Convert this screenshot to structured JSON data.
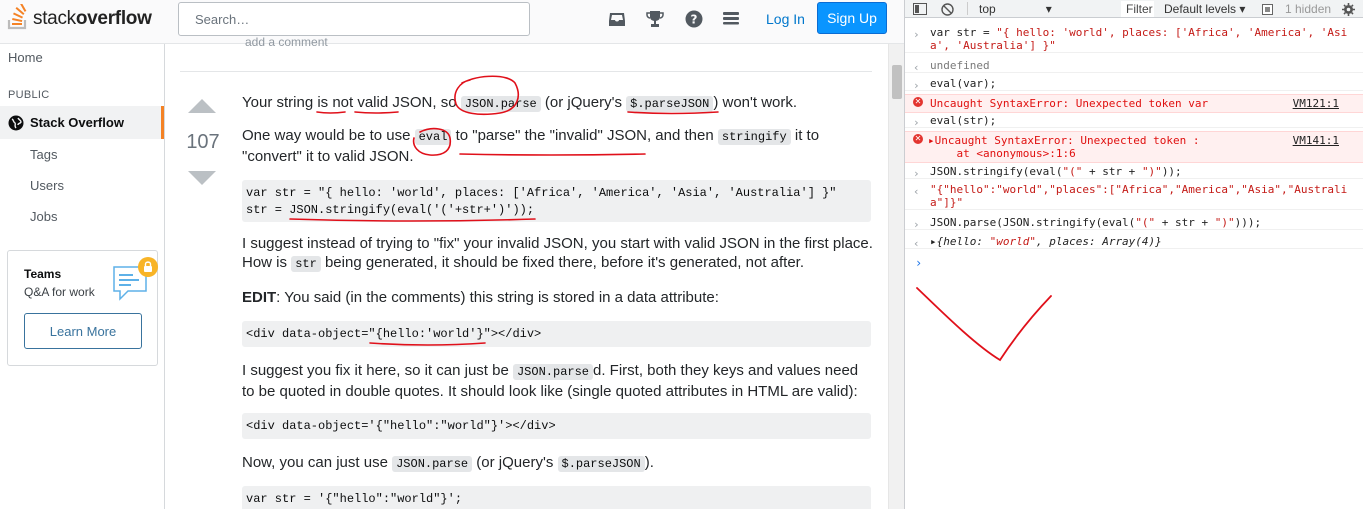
{
  "header": {
    "logo_text_light": "stack",
    "logo_text_bold": "overflow",
    "search_placeholder": "Search…",
    "login_label": "Log In",
    "signup_label": "Sign Up"
  },
  "leftnav": {
    "home": "Home",
    "public_heading": "PUBLIC",
    "stack_overflow": "Stack Overflow",
    "tags": "Tags",
    "users": "Users",
    "jobs": "Jobs",
    "teams_title": "Teams",
    "teams_subtitle": "Q&A for work",
    "learn_more": "Learn More"
  },
  "answer": {
    "add_comment": "add a comment",
    "votes": "107",
    "p1_a": "Your string is not valid JSON, so ",
    "p1_code1": "JSON.parse",
    "p1_b": " (or jQuery's ",
    "p1_code2": "$.parseJSON",
    "p1_c": ") won't work.",
    "p2_a": "One way would be to use ",
    "p2_code1": "eval",
    "p2_b": " to \"parse\" the \"invalid\" JSON, and then ",
    "p2_code2": "stringify",
    "p2_c": " it to \"convert\" it to valid JSON.",
    "code1": "var str = \"{ hello: 'world', places: ['Africa', 'America', 'Asia', 'Australia'] }\"\nstr = JSON.stringify(eval('('+str+')'));",
    "p3_a": "I suggest instead of trying to \"fix\" your invalid JSON, you start with valid JSON in the first place. How is ",
    "p3_code": "str",
    "p3_b": " being generated, it should be fixed there, before it's generated, not after.",
    "p4_bold": "EDIT",
    "p4_rest": ": You said (in the comments) this string is stored in a data attribute:",
    "code2": "<div data-object=\"{hello:'world'}\"></div>",
    "p5_a": "I suggest you fix it here, so it can just be ",
    "p5_code": "JSON.parse",
    "p5_b": "d. First, both they keys and values need to be quoted in double quotes. It should look like (single quoted attributes in HTML are valid):",
    "code3": "<div data-object='{\"hello\":\"world\"}'></div>",
    "p6_a": "Now, you can just use ",
    "p6_code1": "JSON.parse",
    "p6_b": " (or jQuery's ",
    "p6_code2": "$.parseJSON",
    "p6_c": ").",
    "code4": "var str = '{\"hello\":\"world\"}';"
  },
  "devtools": {
    "context": "top",
    "filter": "Filter",
    "levels": "Default levels ▾",
    "hidden": "1 hidden",
    "lines": {
      "l1_a": "var str = ",
      "l1_str": "\"{ hello: 'world', places: ['Africa', 'America', 'Asia', 'Australia'] }\"",
      "l2": "undefined",
      "l3": "eval(var);",
      "l4": "Uncaught SyntaxError: Unexpected token var",
      "l4_src": "VM121:1",
      "l5": "eval(str);",
      "l6": "Uncaught SyntaxError: Unexpected token :\n    at <anonymous>:1:6",
      "l6_src": "VM141:1",
      "l7_a": "JSON.stringify(eval(",
      "l7_s1": "\"(\"",
      "l7_b": " + str + ",
      "l7_s2": "\")\"",
      "l7_c": "));",
      "l8": "\"{\"hello\":\"world\",\"places\":[\"Africa\",\"America\",\"Asia\",\"Australia\"]}\"",
      "l9_a": "JSON.parse(JSON.stringify(eval(",
      "l9_s1": "\"(\"",
      "l9_b": " + str + ",
      "l9_s2": "\")\"",
      "l9_c": ")));",
      "l10_a": "{hello: ",
      "l10_s": "\"world\"",
      "l10_b": ", places: Array(4)}"
    }
  },
  "colors": {
    "brand_orange": "#f48225",
    "link_blue": "#0077cc",
    "signup_blue": "#0a95ff",
    "annotation_red": "#e0101a",
    "console_error_red": "#e0100f"
  }
}
